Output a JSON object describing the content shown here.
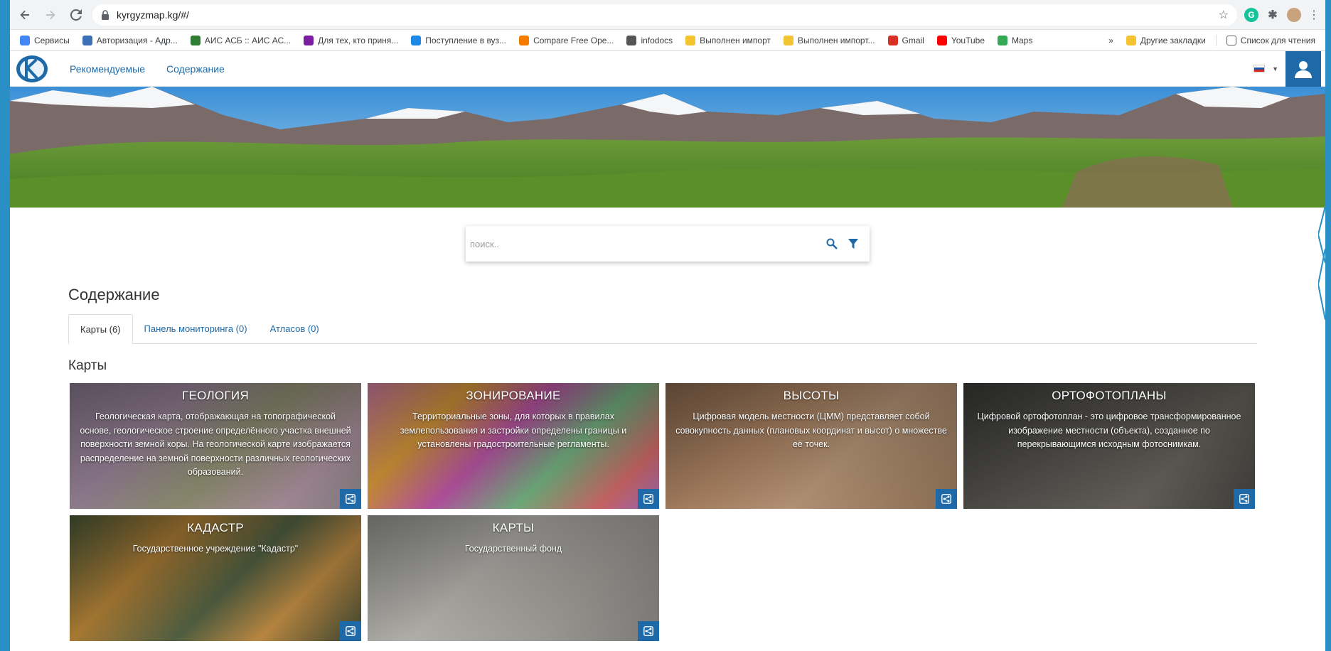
{
  "browser": {
    "url": "kyrgyzmap.kg/#/",
    "bookmarks": [
      {
        "label": "Сервисы",
        "color": "#4285f4"
      },
      {
        "label": "Авторизация - Адр...",
        "color": "#3b6fb6"
      },
      {
        "label": "АИС АСБ :: АИС АС...",
        "color": "#2e7d32"
      },
      {
        "label": "Для тех, кто приня...",
        "color": "#7b1fa2"
      },
      {
        "label": "Поступление в вуз...",
        "color": "#1e88e5"
      },
      {
        "label": "Compare Free Ope...",
        "color": "#f57c00"
      },
      {
        "label": "infodocs",
        "color": "#555555"
      },
      {
        "label": "Выполнен импорт",
        "color": "#f4c430"
      },
      {
        "label": "Выполнен импорт...",
        "color": "#f4c430"
      },
      {
        "label": "Gmail",
        "color": "#d93025"
      },
      {
        "label": "YouTube",
        "color": "#ff0000"
      },
      {
        "label": "Maps",
        "color": "#34a853"
      }
    ],
    "overflow": "»",
    "other_bookmarks": "Другие закладки",
    "reading_list": "Список для чтения"
  },
  "site": {
    "nav": {
      "recommended": "Рекомендуемые",
      "contents": "Содержание"
    },
    "search_placeholder": "поиск..",
    "section_title": "Содержание",
    "tabs": [
      {
        "label": "Карты (6)",
        "active": true
      },
      {
        "label": "Панель мониторинга (0)",
        "active": false
      },
      {
        "label": "Атласов (0)",
        "active": false
      }
    ],
    "maps_title": "Карты",
    "cards": [
      {
        "title": "ГЕОЛОГИЯ",
        "desc": "Геологическая карта, отображающая на топографической основе, геологическое строение определённого участка внешней поверхности земной коры. На геологической карте изображается распределение на земной поверхности различных геологических образований.",
        "theme": "geology"
      },
      {
        "title": "ЗОНИРОВАНИЕ",
        "desc": "Территориальные зоны, для которых в правилах землепользования и застройки определены границы и установлены градостроительные регламенты.",
        "theme": "zoning"
      },
      {
        "title": "ВЫСОТЫ",
        "desc": "Цифровая модель местности (ЦММ) представляет собой совокупность данных (плановых координат и высот) о множестве её точек.",
        "theme": "heights"
      },
      {
        "title": "ОРТОФОТОПЛАНЫ",
        "desc": "Цифровой ортофотоплан - это цифровое трансформированное изображение местности (объекта), созданное по перекрывающимся исходным фотоснимкам.",
        "theme": "ortho"
      },
      {
        "title": "КАДАСТР",
        "desc": "Государственное учреждение \"Кадастр\"",
        "theme": "cadastre"
      },
      {
        "title": "КАРТЫ",
        "desc": "Государственный фонд",
        "theme": "maps"
      }
    ]
  }
}
